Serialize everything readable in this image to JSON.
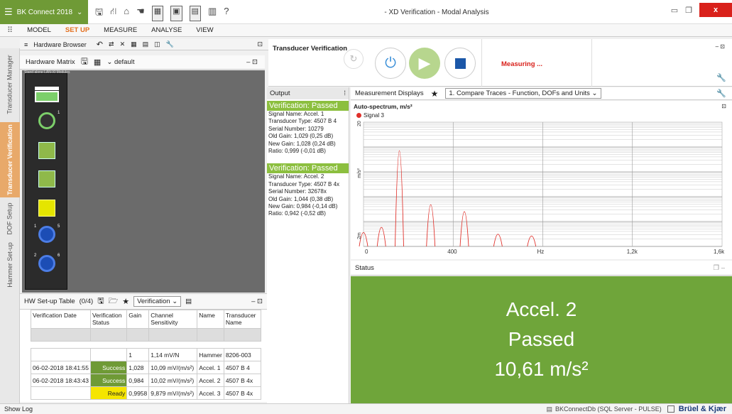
{
  "app": {
    "menu_label": "BK Connect 2018",
    "window_title": "- XD Verification - Modal Analysis",
    "help": "?"
  },
  "ribbon": {
    "tabs": [
      "MODEL",
      "SET UP",
      "MEASURE",
      "ANALYSE",
      "VIEW"
    ],
    "active": "SET UP"
  },
  "side_tabs": [
    "Transducer Manager",
    "Transducer Verification",
    "DOF Setup",
    "Hammer Set-up"
  ],
  "hw_browser": {
    "title": "Hardware Browser"
  },
  "hw_matrix": {
    "title": "Hardware Matrix",
    "view": "default",
    "module_label": "Stand alone LAN-XI Modules",
    "slot_numbers": [
      "1",
      "2",
      "5",
      "6"
    ]
  },
  "hw_table": {
    "title": "HW Set-up Table",
    "count": "(0/4)",
    "filter": "Verification",
    "columns": [
      "Verification Date",
      "Verification Status",
      "Gain",
      "Channel Sensitivity",
      "Name",
      "Transducer Name"
    ],
    "rows": [
      [
        "",
        "",
        "1",
        "1,14 mV/N",
        "Hammer",
        "8206-003"
      ],
      [
        "06-02-2018 18:41:55",
        "Success",
        "1,028",
        "10,09 mV/(m/s²)",
        "Accel. 1",
        "4507 B 4"
      ],
      [
        "06-02-2018 18:43:43",
        "Success",
        "0,984",
        "10,02 mV/(m/s²)",
        "Accel. 2",
        "4507 B 4x"
      ],
      [
        "",
        "Ready",
        "0,9958",
        "9,879 mV/(m/s²)",
        "Accel. 3",
        "4507 B 4x"
      ]
    ]
  },
  "transducer_verification": {
    "title": "Transducer Verification",
    "status": "Measuring ..."
  },
  "output": {
    "title": "Output",
    "blocks": [
      {
        "header": "Verification: Passed",
        "lines": [
          "Signal Name: Accel. 1",
          "Transducer Type: 4507 B 4",
          "Serial Number: 10279",
          "Old Gain: 1,029 (0,25 dB)",
          "New Gain: 1,028 (0,24 dB)",
          "Ratio: 0,999 (-0,01 dB)"
        ]
      },
      {
        "header": "Verification: Passed",
        "lines": [
          "Signal Name: Accel. 2",
          "Transducer Type: 4507 B 4x",
          "Serial Number: 32678x",
          "Old Gain: 1,044 (0,38 dB)",
          "New Gain: 0,984 (-0,14 dB)",
          "Ratio: 0,942 (-0,52 dB)"
        ]
      }
    ]
  },
  "measurement_displays": {
    "title": "Measurement Displays",
    "selected": "1. Compare Traces - Function, DOFs and Units"
  },
  "chart_data": {
    "type": "line",
    "title": "Auto-spectrum, m/s²",
    "series": [
      {
        "name": "Signal 3",
        "color": "#e0302a",
        "peaks": [
          [
            0,
            8
          ],
          [
            80,
            11
          ],
          [
            160,
            55
          ],
          [
            300,
            24
          ],
          [
            450,
            20
          ],
          [
            600,
            7
          ],
          [
            750,
            6
          ]
        ]
      }
    ],
    "x_ticks": [
      "0",
      "400",
      "Hz",
      "1,2k",
      "1,6k"
    ],
    "y_ticks": [
      "20",
      "m/s²",
      "2m"
    ],
    "xlim": [
      0,
      1600
    ],
    "log_y": true
  },
  "status": {
    "title": "Status",
    "lines": [
      "Accel. 2",
      "Passed",
      "10,61 m/s²"
    ],
    "color": "#6fa53a"
  },
  "bottom": {
    "show_log": "Show Log",
    "db": "BKConnectDb (SQL Server - PULSE)",
    "brand": "Brüel & Kjær"
  }
}
